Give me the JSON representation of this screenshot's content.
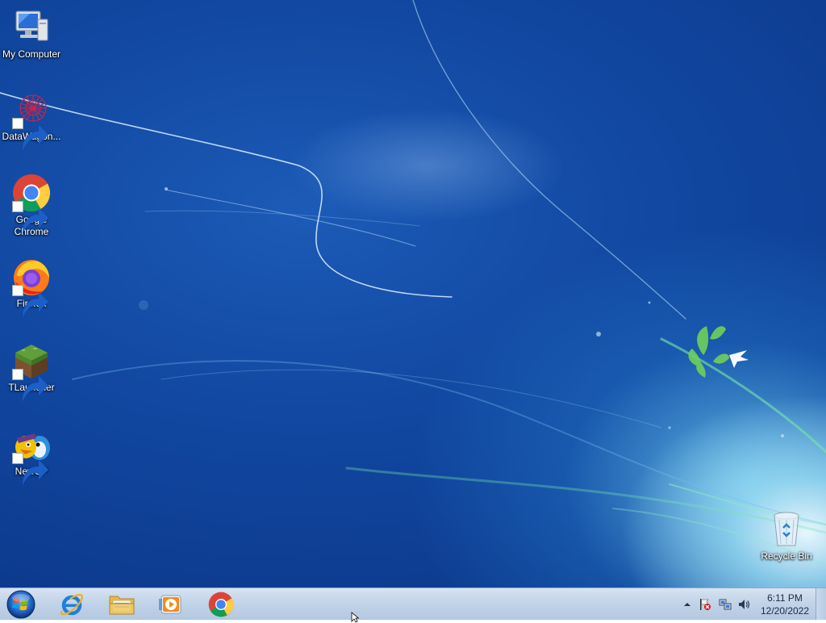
{
  "desktop": {
    "icons": [
      {
        "label": "My Computer",
        "icon": "computer-icon",
        "shortcut": false
      },
      {
        "label": "DataWagon...",
        "icon": "datawagon-icon",
        "shortcut": true
      },
      {
        "label": "Google Chrome",
        "icon": "chrome-icon",
        "shortcut": true
      },
      {
        "label": "Firefox",
        "icon": "firefox-icon",
        "shortcut": true
      },
      {
        "label": "TLauncher",
        "icon": "tlauncher-icon",
        "shortcut": true
      },
      {
        "label": "NewCP",
        "icon": "newcp-icon",
        "shortcut": true
      },
      {
        "label": "Recycle Bin",
        "icon": "recycle-bin-icon",
        "shortcut": false
      }
    ]
  },
  "taskbar": {
    "start": {
      "icon": "windows-start-icon"
    },
    "pinned": [
      {
        "name": "Internet Explorer",
        "icon": "internet-explorer-icon"
      },
      {
        "name": "Windows Explorer",
        "icon": "folder-icon"
      },
      {
        "name": "Windows Media Player",
        "icon": "media-player-icon"
      },
      {
        "name": "Google Chrome",
        "icon": "chrome-icon"
      }
    ],
    "tray": {
      "icons": [
        "show-hidden-icons-arrow",
        "action-center-flag-icon",
        "network-icon",
        "volume-icon"
      ],
      "clock": {
        "time": "6:11 PM",
        "date": "12/20/2022"
      }
    }
  },
  "colors": {
    "desktop_blue": "#1249a3",
    "taskbar": "#c2d4e8",
    "label_text": "#ffffff"
  }
}
